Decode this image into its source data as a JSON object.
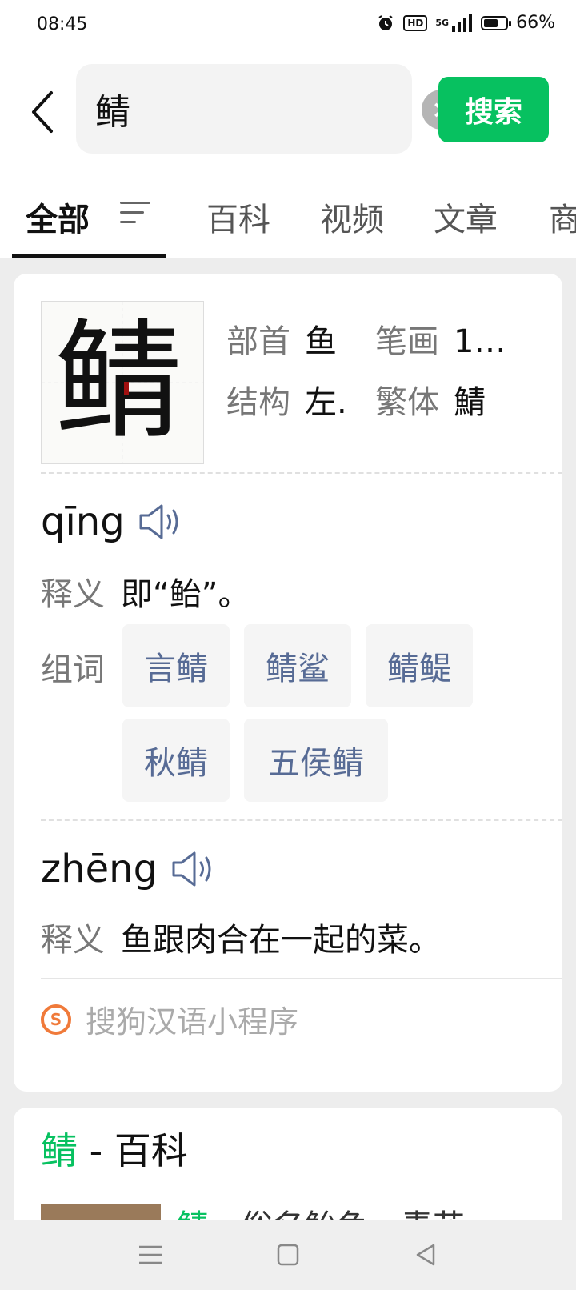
{
  "status_bar": {
    "time": "08:45",
    "battery": "66%",
    "battery_level": 0.66,
    "hd_label": "HD",
    "network_label": "5G",
    "icons": [
      "alarm-icon",
      "hd-icon",
      "signal-icon",
      "battery-icon"
    ]
  },
  "search": {
    "query": "鲭",
    "button_label": "搜索",
    "clear_icon": "×"
  },
  "tabs": [
    {
      "label": "全部",
      "active": true
    },
    {
      "label": "百科"
    },
    {
      "label": "视频"
    },
    {
      "label": "文章"
    },
    {
      "label": "商"
    }
  ],
  "character_card": {
    "character": "鲭",
    "radical_label": "部首",
    "radical_value": "鱼",
    "strokes_label": "笔画",
    "strokes_value": "1…",
    "structure_label": "结构",
    "structure_value": "左.",
    "traditional_label": "繁体",
    "traditional_value": "鯖",
    "readings": [
      {
        "pinyin": "qīng",
        "def_label": "释义",
        "definition": "即“鲐”。",
        "words_label": "组词",
        "words": [
          "言鲭",
          "鲭鲨",
          "鲭鳀",
          "秋鲭",
          "五侯鲭"
        ]
      },
      {
        "pinyin": "zhēng",
        "def_label": "释义",
        "definition": "鱼跟肉合在一起的菜。"
      }
    ],
    "source": "搜狗汉语小程序",
    "source_logo": "S"
  },
  "baike_card": {
    "title_highlight": "鲭",
    "title_rest": " - 百科",
    "snippet_highlight": "鲭",
    "snippet_rest": "，俗名鲐鱼，青花"
  },
  "colors": {
    "accent": "#07c160",
    "link": "#576b95",
    "source_orange": "#f07a3a"
  }
}
